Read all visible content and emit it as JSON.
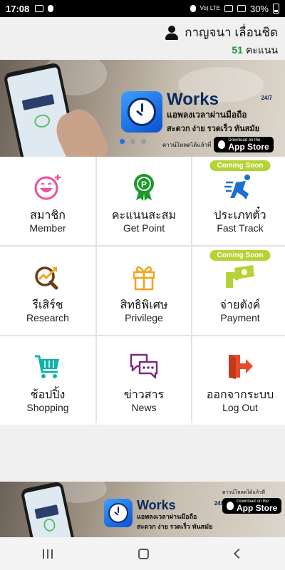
{
  "status_bar": {
    "time": "17:08",
    "network": "Vo) LTE",
    "battery_label": "30%"
  },
  "header": {
    "user_name": "กาญจนา เลื่อนชิด",
    "points_value": "51",
    "points_unit": "คะแนน"
  },
  "banner": {
    "brand": "Works",
    "brand_sup": "24/7",
    "line1": "แอพลงเวลาผ่านมือถือ",
    "line2": "สะดวก ง่าย รวดเร็ว ทันสมัย",
    "download_text": "ดาวน์โหลดได้แล้วที่",
    "appstore_small": "Download on the",
    "appstore_big": "App Store"
  },
  "menu": {
    "coming_soon": "Coming Soon",
    "items": [
      {
        "th": "สมาชิก",
        "en": "Member"
      },
      {
        "th": "คะแนนสะสม",
        "en": "Get Point"
      },
      {
        "th": "ประเภทตั๋ว",
        "en": "Fast Track"
      },
      {
        "th": "รีเสิร์ช",
        "en": "Research"
      },
      {
        "th": "สิทธิพิเศษ",
        "en": "Privilege"
      },
      {
        "th": "จ่ายตังค์",
        "en": "Payment"
      },
      {
        "th": "ช้อปปิ้ง",
        "en": "Shopping"
      },
      {
        "th": "ข่าวสาร",
        "en": "News"
      },
      {
        "th": "ออกจากระบบ",
        "en": "Log Out"
      }
    ]
  },
  "icons": {
    "member": "smiley-plus-icon",
    "get_point": "award-ribbon-icon",
    "fast_track": "running-man-icon",
    "research": "magnifier-chart-icon",
    "privilege": "gift-box-icon",
    "payment": "cash-payment-icon",
    "shopping": "shopping-cart-icon",
    "news": "chat-bubbles-icon",
    "logout": "exit-door-icon"
  },
  "colors": {
    "pink": "#f04f9b",
    "green": "#1a9a2a",
    "blue": "#1a6fd0",
    "brown": "#6b3d12",
    "orange": "#f3a51c",
    "lime": "#b5d334",
    "teal": "#0fb4a8",
    "purple": "#7a2b7e",
    "red": "#e74b2c"
  }
}
